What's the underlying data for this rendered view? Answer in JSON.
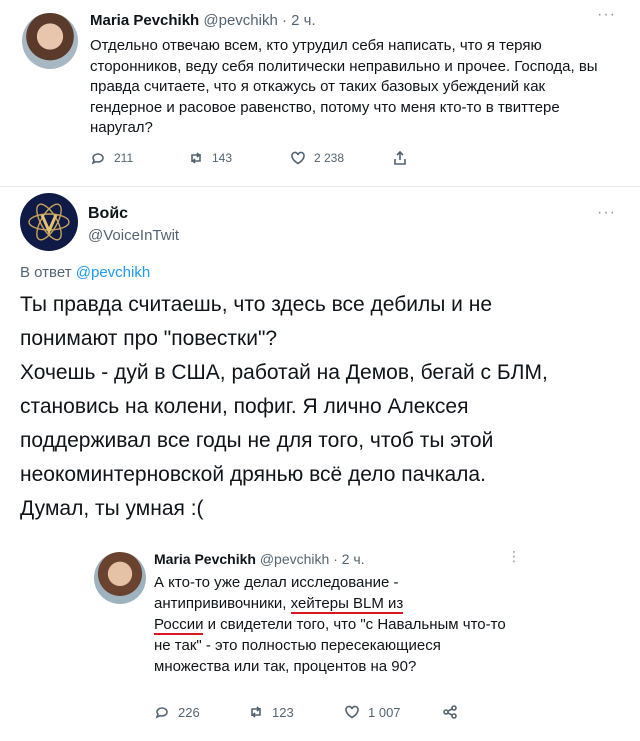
{
  "tweet1": {
    "author_name": "Maria Pevchikh",
    "author_handle": "@pevchikh",
    "time": "· 2 ч.",
    "more": "···",
    "text": "Отдельно отвечаю всем, кто утрудил себя написать, что я теряю сторонников, веду себя политически неправильно и прочее. Господа, вы правда считаете, что я откажусь от таких базовых убеждений как гендерное и расовое равенство, потому что меня кто-то в твиттере наругал?",
    "actions": {
      "replies": "211",
      "retweets": "143",
      "likes": "2 238"
    },
    "icons": [
      "reply-icon",
      "retweet-icon",
      "like-icon",
      "share-icon"
    ]
  },
  "tweet2": {
    "author_name": "Войс",
    "author_handle": "@VoiceInTwit",
    "more": "···",
    "reply_prefix": "В ответ",
    "reply_mention": "@pevchikh",
    "lines": [
      "Ты правда считаешь, что здесь все дебилы и не",
      "понимают про \"повестки\"?",
      "Хочешь - дуй в США, работай на Демов, бегай с БЛМ,",
      "становись на колени, пофиг. Я лично Алексея",
      "поддерживал все годы не для того, чтоб ты этой",
      "неокоминтерновской дрянью всё дело пачкала.",
      "Думал, ты умная :("
    ]
  },
  "quoted": {
    "author_name": "Maria Pevchikh",
    "author_handle": "@pevchikh",
    "time": "· 2 ч.",
    "more": "⋮",
    "text_a": "А кто-то уже делал исследование - антипрививочники, ",
    "text_underlined_1": "хейтеры BLM из",
    "text_underlined_2": "России",
    "text_b": " и свидетели того, что \"с Навальным что-то не так\" - это полностью пересекающиеся множества или так, процентов на 90?",
    "actions": {
      "replies": "226",
      "retweets": "123",
      "likes": "1 007"
    },
    "underline_color": "#d9181f"
  },
  "colors": {
    "link": "#1d9bf0",
    "muted": "#536471",
    "text": "#0f1419"
  }
}
